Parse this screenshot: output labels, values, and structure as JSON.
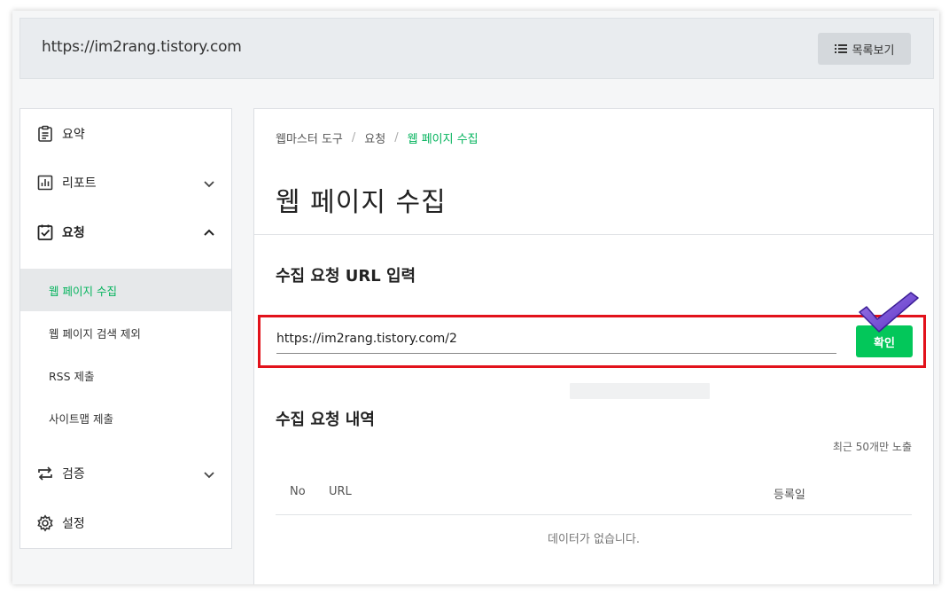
{
  "header": {
    "site_url": "https://im2rang.tistory.com",
    "list_button_label": "목록보기"
  },
  "sidebar": {
    "items": [
      {
        "label": "요약",
        "icon": "clipboard-icon"
      },
      {
        "label": "리포트",
        "icon": "bar-chart-icon",
        "expandable": true,
        "expanded": false
      },
      {
        "label": "요청",
        "icon": "clipboard-check-icon",
        "expandable": true,
        "expanded": true
      },
      {
        "label": "검증",
        "icon": "repeat-icon",
        "expandable": true,
        "expanded": false
      },
      {
        "label": "설정",
        "icon": "gear-icon"
      }
    ],
    "sub_items": [
      {
        "label": "웹 페이지 수집",
        "active": true
      },
      {
        "label": "웹 페이지 검색 제외",
        "active": false
      },
      {
        "label": "RSS 제출",
        "active": false
      },
      {
        "label": "사이트맵 제출",
        "active": false
      }
    ]
  },
  "main": {
    "breadcrumb": [
      "웹마스터 도구",
      "요청",
      "웹 페이지 수집"
    ],
    "page_title": "웹 페이지 수집",
    "url_section_title": "수집 요청 URL 입력",
    "url_input_value": "https://im2rang.tistory.com/2",
    "confirm_label": "확인",
    "history_section_title": "수집 요청 내역",
    "recent_note": "최근 50개만 노출",
    "table_headers": [
      "No",
      "URL",
      "등록일"
    ],
    "empty_message": "데이터가 없습니다."
  },
  "colors": {
    "accent_green": "#03c75a",
    "highlight_red": "#e2121b",
    "check_purple": "#7b4fd6"
  }
}
